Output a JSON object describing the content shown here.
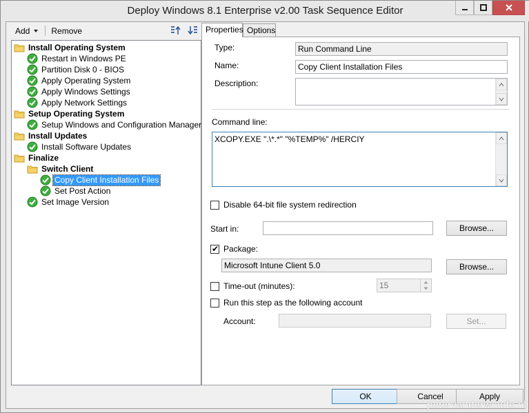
{
  "window": {
    "title": "Deploy Windows 8.1 Enterprise v2.00 Task Sequence Editor"
  },
  "toolbar": {
    "add_label": "Add",
    "remove_label": "Remove"
  },
  "tree": {
    "items": [
      {
        "label": "Install Operating System",
        "type": "group"
      },
      {
        "label": "Restart in Windows PE",
        "type": "step"
      },
      {
        "label": "Partition Disk 0 - BIOS",
        "type": "step"
      },
      {
        "label": "Apply Operating System",
        "type": "step"
      },
      {
        "label": "Apply Windows Settings",
        "type": "step"
      },
      {
        "label": "Apply Network Settings",
        "type": "step"
      },
      {
        "label": "Setup Operating System",
        "type": "group"
      },
      {
        "label": "Setup Windows and Configuration Manager",
        "type": "step"
      },
      {
        "label": "Install Updates",
        "type": "group"
      },
      {
        "label": "Install Software Updates",
        "type": "step"
      },
      {
        "label": "Finalize",
        "type": "group"
      },
      {
        "label": "Switch Client",
        "type": "group"
      },
      {
        "label": "Copy Client Installation Files",
        "type": "step",
        "selected": true
      },
      {
        "label": "Set Post Action",
        "type": "step"
      },
      {
        "label": "Set Image Version",
        "type": "step"
      }
    ]
  },
  "tabs": {
    "properties": "Properties",
    "options": "Options"
  },
  "properties": {
    "type_label": "Type:",
    "type_value": "Run Command Line",
    "name_label": "Name:",
    "name_value": "Copy Client Installation Files",
    "description_label": "Description:",
    "description_value": "",
    "command_line_label": "Command line:",
    "command_line_value": "XCOPY.EXE \".\\*.*\" \"%TEMP%\" /HERCIY",
    "disable_redirection_label": "Disable 64-bit file system redirection",
    "disable_redirection_checked": false,
    "start_in_label": "Start in:",
    "start_in_value": "",
    "browse_label": "Browse...",
    "package_label": "Package:",
    "package_checked": true,
    "package_value": "Microsoft Intune Client 5.0",
    "timeout_label": "Time-out (minutes):",
    "timeout_checked": false,
    "timeout_value": "15",
    "run_as_label": "Run this step as the following account",
    "run_as_checked": false,
    "account_label": "Account:",
    "account_value": "",
    "set_label": "Set..."
  },
  "footer": {
    "ok_label": "OK",
    "cancel_label": "Cancel",
    "apply_label": "Apply"
  },
  "watermark": "petervanderwoude.nl",
  "colors": {
    "selection": "#3399ff",
    "close_button": "#c75050",
    "check_green": "#2e9e2e"
  }
}
